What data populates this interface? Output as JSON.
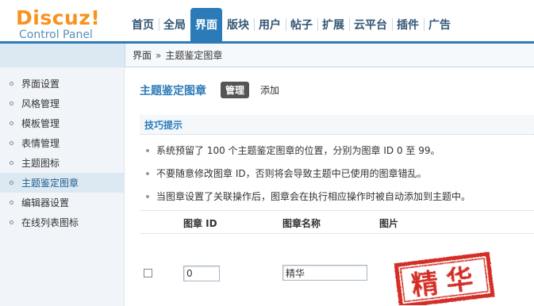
{
  "header": {
    "logo_main_a": "Discuz",
    "logo_main_b": "!",
    "logo_sub": "Control Panel",
    "nav": [
      "首页",
      "全局",
      "界面",
      "版块",
      "用户",
      "帖子",
      "扩展",
      "云平台",
      "插件",
      "广告"
    ],
    "nav_active": "界面"
  },
  "breadcrumb": {
    "parent": "界面",
    "separator": "»",
    "current": "主题鉴定图章"
  },
  "sidebar": {
    "items": [
      "界面设置",
      "风格管理",
      "模板管理",
      "表情管理",
      "主题图标",
      "主题鉴定图章",
      "编辑器设置",
      "在线列表图标"
    ],
    "active": "主题鉴定图章"
  },
  "main": {
    "title": "主题鉴定图章",
    "tabs": [
      "管理",
      "添加"
    ],
    "active_tab": "管理",
    "tips_title": "技巧提示",
    "tips": [
      "系统预留了 100 个主题鉴定图章的位置，分别为图章 ID 0 至 99。",
      "不要随意修改图章 ID，否则将会导致主题中已使用的图章错乱。",
      "当图章设置了关联操作后，图章会在执行相应操作时被自动添加到主题中。"
    ],
    "columns": [
      "图章 ID",
      "图章名称",
      "图片"
    ],
    "rows": [
      {
        "checked": false,
        "id": "0",
        "name": "精华",
        "image_text": "精华",
        "image_color": "#d22d25"
      }
    ]
  },
  "colors": {
    "accent": "#2b7bb9",
    "logo": "#f7931e",
    "stamp": "#d22d25"
  }
}
